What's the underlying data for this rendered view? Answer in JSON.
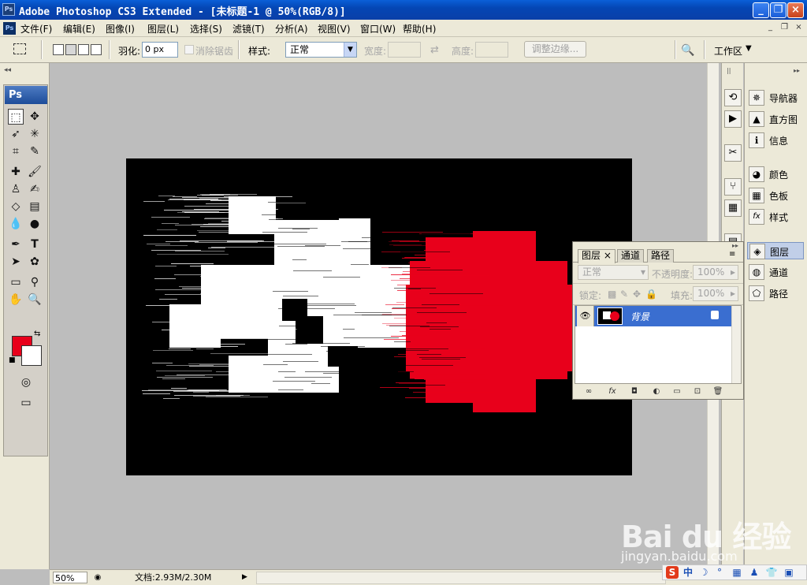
{
  "window": {
    "title": "Adobe Photoshop CS3 Extended - [未标题-1 @ 50%(RGB/8)]",
    "app_badge": "Ps",
    "controls": [
      "_",
      "❐",
      "×"
    ]
  },
  "menu": {
    "items": [
      "文件(F)",
      "编辑(E)",
      "图像(I)",
      "图层(L)",
      "选择(S)",
      "滤镜(T)",
      "分析(A)",
      "视图(V)",
      "窗口(W)",
      "帮助(H)"
    ],
    "doc_controls": [
      "_",
      "❐",
      "×"
    ]
  },
  "options_bar": {
    "feather_label": "羽化:",
    "feather_value": "0 px",
    "antialias_label": "消除锯齿",
    "style_label": "样式:",
    "style_value": "正常",
    "width_label": "宽度:",
    "height_label": "高度:",
    "refine_edge_button": "调整边缘...",
    "workspace_label": "工作区"
  },
  "toolbox": {
    "logo": "Ps",
    "foreground_color": "#e8001b",
    "background_color": "#ffffff"
  },
  "status_bar": {
    "zoom": "50%",
    "doc_info": "文档:2.93M/2.30M"
  },
  "panels": {
    "group1": [
      "导航器",
      "直方图",
      "信息"
    ],
    "group2": [
      "颜色",
      "色板",
      "样式"
    ],
    "group3": [
      "图层",
      "通道",
      "路径"
    ]
  },
  "layers_panel": {
    "tabs": [
      "图层",
      "通道",
      "路径"
    ],
    "blend_mode": "正常",
    "opacity_label": "不透明度:",
    "opacity_value": "100%",
    "lock_label": "锁定:",
    "fill_label": "填充:",
    "fill_value": "100%",
    "layer_name": "背景"
  },
  "watermark": {
    "logo": "Bai du 经验",
    "site": "jingyan.baidu.com"
  },
  "ime": {
    "items": [
      "S",
      "中",
      "☽",
      "°",
      "▦",
      "♟",
      "👕",
      "▣"
    ]
  },
  "colors": {
    "canvas_bg": "#000000",
    "shape_red": "#e8001b",
    "shape_white": "#ffffff",
    "layer_highlight": "#3a6ed0"
  }
}
